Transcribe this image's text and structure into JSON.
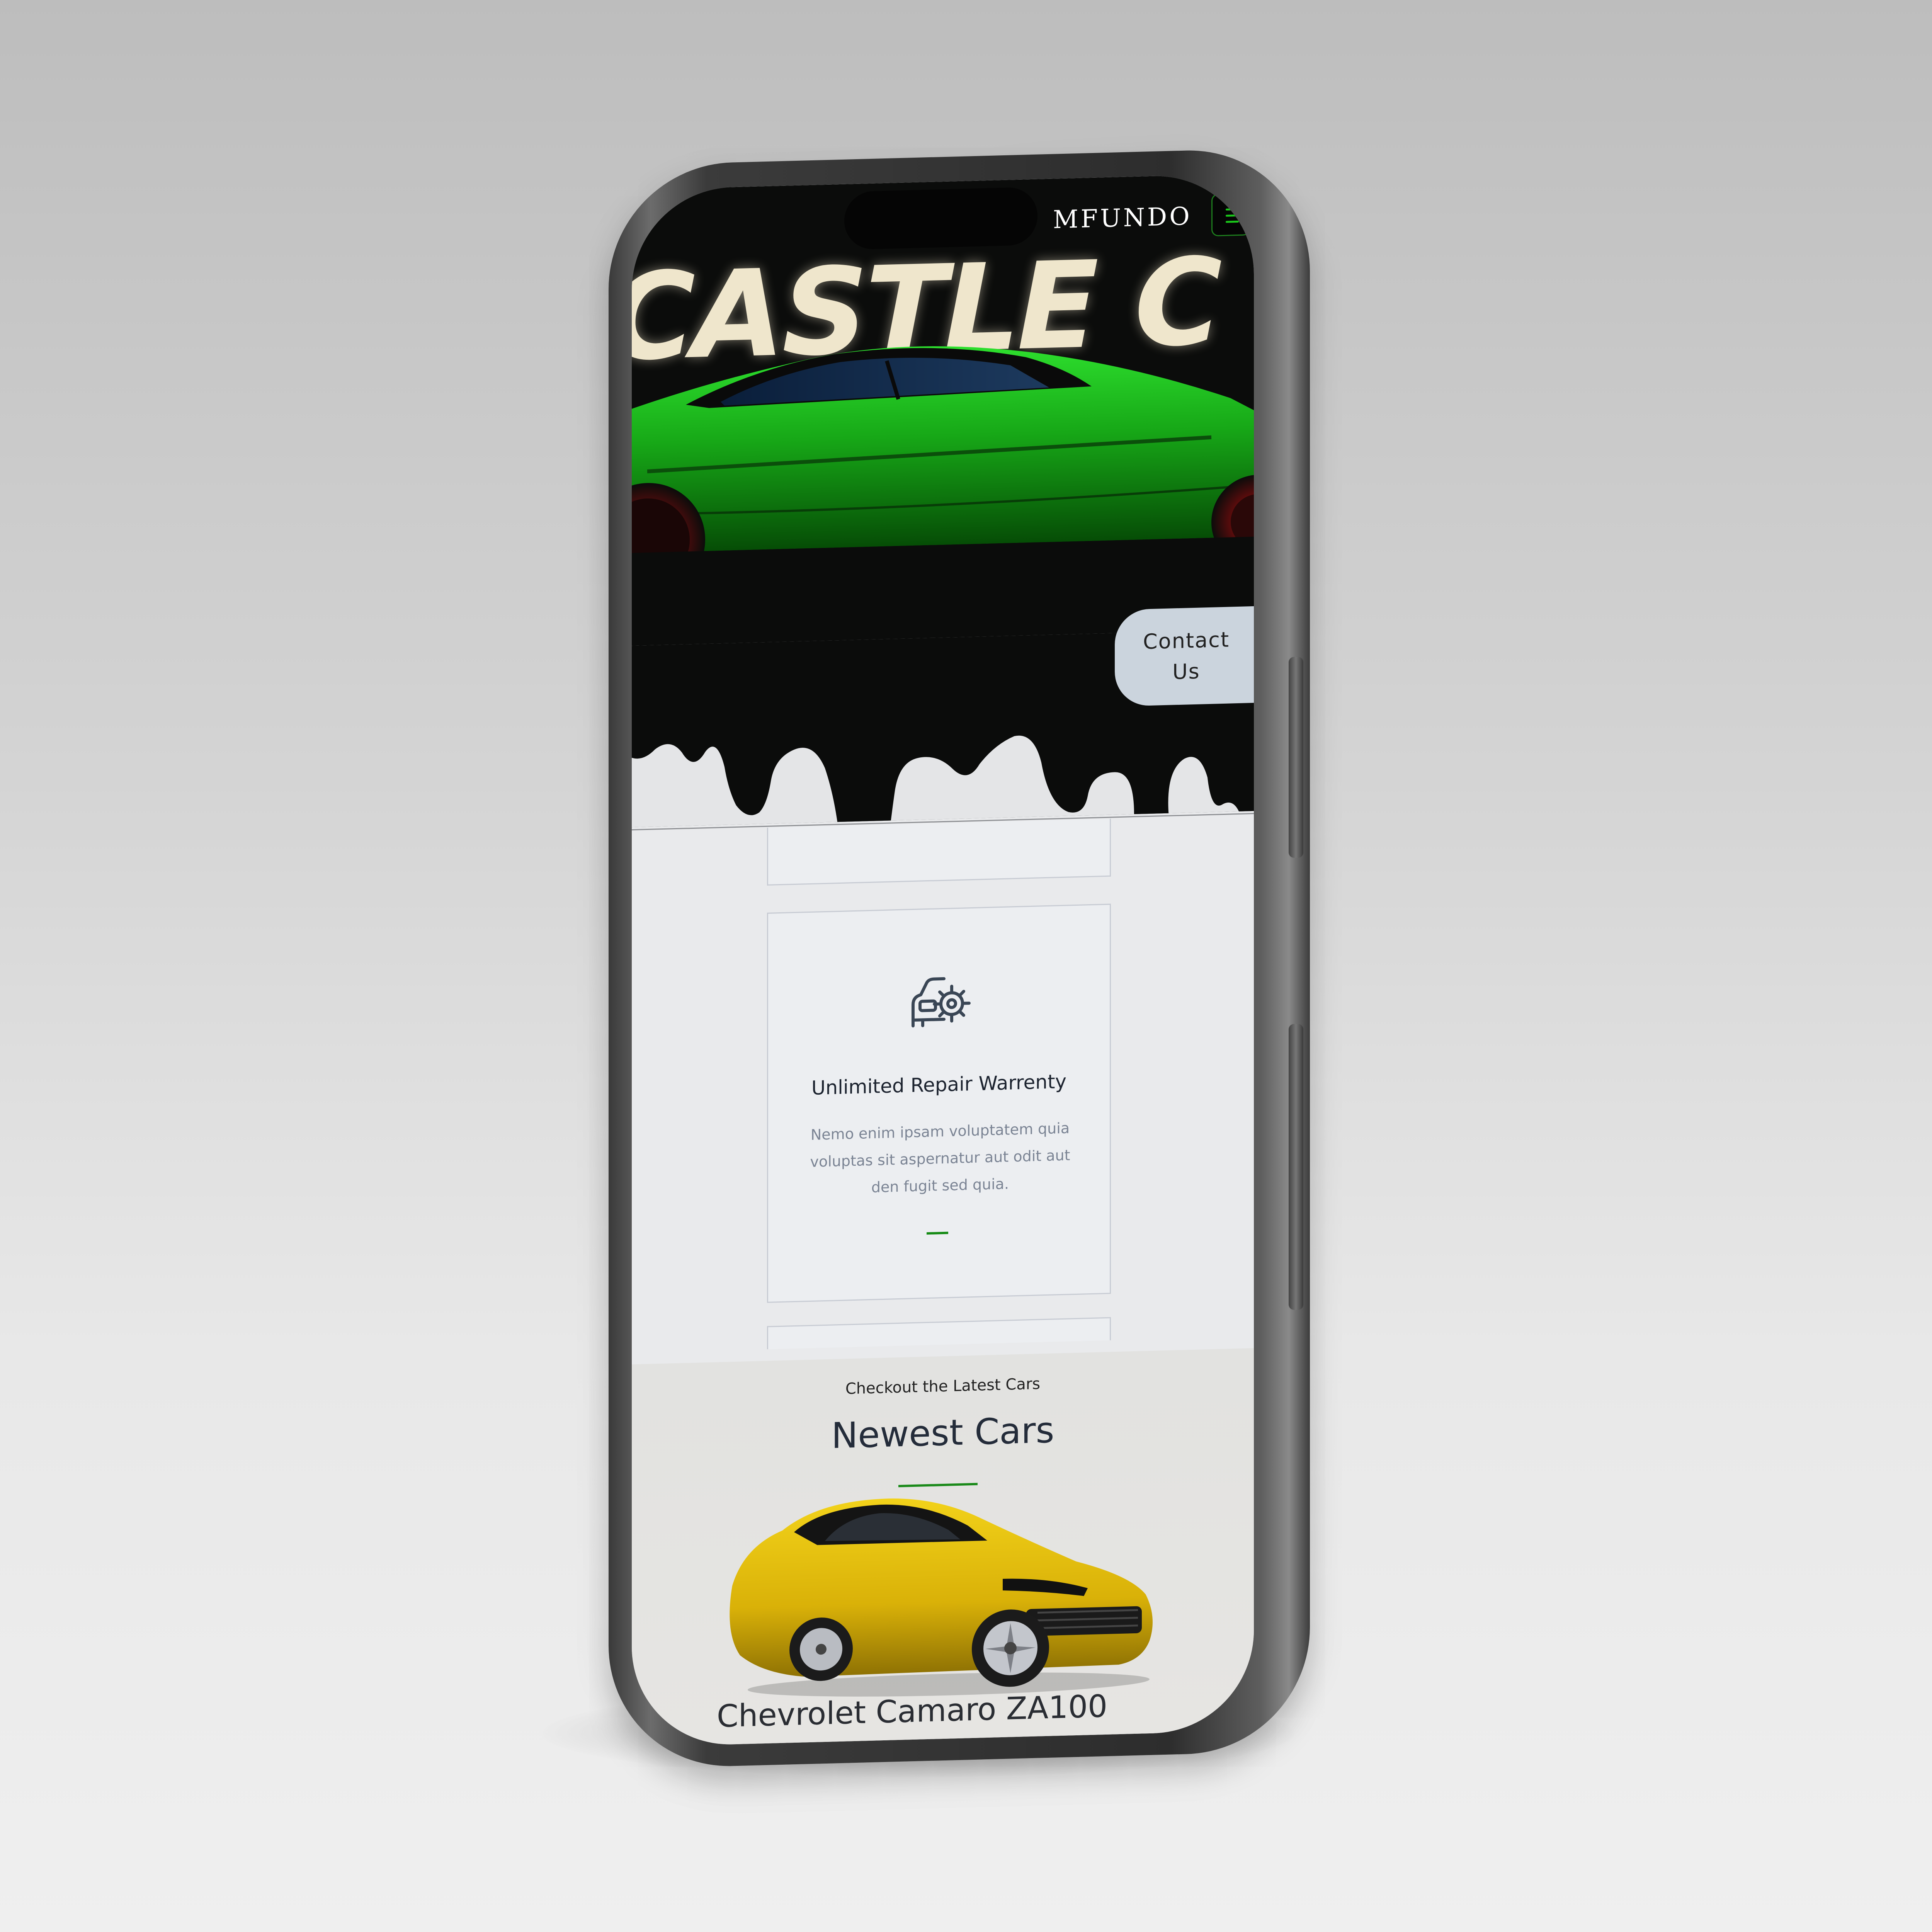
{
  "header": {
    "brand": "MFUNDO",
    "menu_icon": "hamburger-menu-icon"
  },
  "hero": {
    "title": "ICASTLE C",
    "contact_label_line1": "Contact",
    "contact_label_line2": "Us",
    "car_color": "#19b219"
  },
  "feature_card": {
    "icon": "car-gear-repair-icon",
    "title": "Unlimited Repair Warrenty",
    "text_line1": "Nemo enim ipsam voluptatem quia",
    "text_line2": "voluptas sit aspernatur aut odit aut",
    "text_line3": "den fugit sed quia."
  },
  "newest": {
    "subtitle": "Checkout the Latest Cars",
    "title": "Newest Cars",
    "car_name": "Chevrolet Camaro ZA100",
    "car_color": "#e6c20a"
  },
  "colors": {
    "accent_green": "#138a13",
    "hero_background": "#0b0c0b",
    "page_background": "#e9eaec"
  }
}
